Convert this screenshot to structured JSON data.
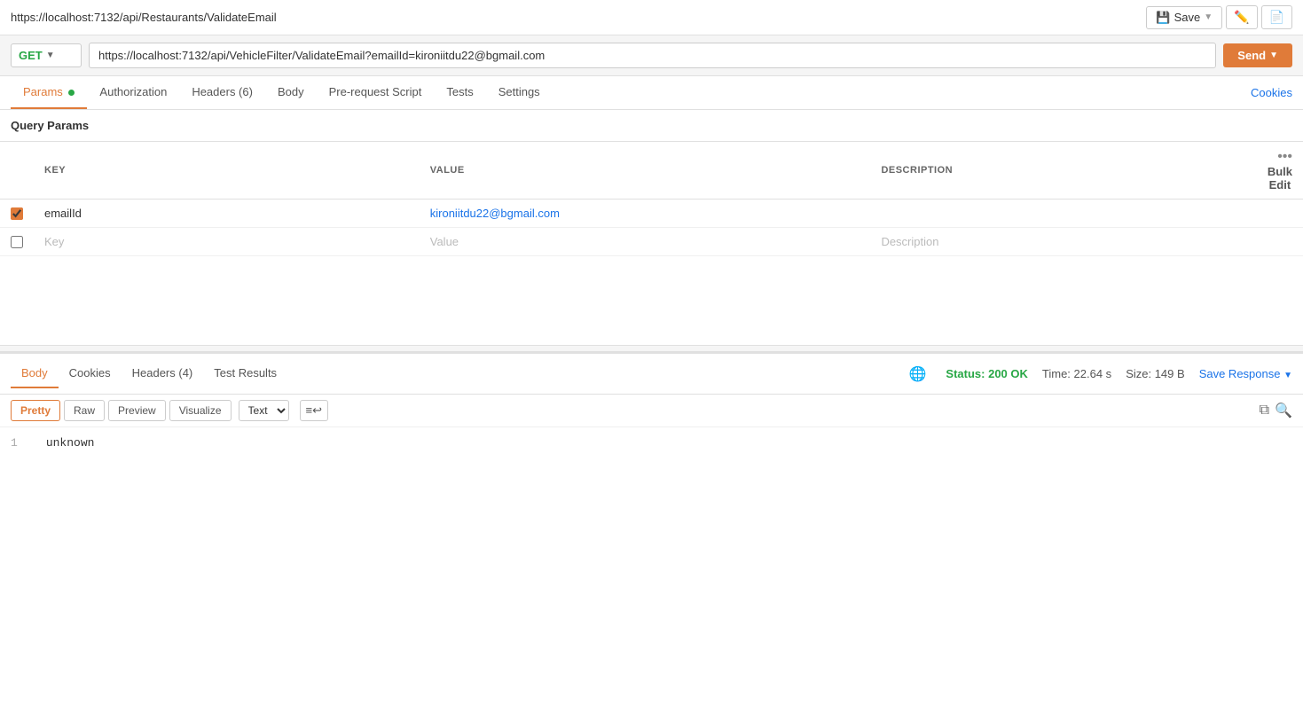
{
  "topbar": {
    "title": "https://localhost:7132/api/Restaurants/ValidateEmail",
    "save_label": "Save"
  },
  "urlbar": {
    "method": "GET",
    "url": "https://localhost:7132/api/VehicleFilter/ValidateEmail?emailId=kironiitdu22@bgmail.com",
    "send_label": "Send"
  },
  "request_tabs": [
    {
      "id": "params",
      "label": "Params",
      "active": true,
      "dot": true
    },
    {
      "id": "authorization",
      "label": "Authorization",
      "active": false,
      "dot": false
    },
    {
      "id": "headers",
      "label": "Headers (6)",
      "active": false,
      "dot": false
    },
    {
      "id": "body",
      "label": "Body",
      "active": false,
      "dot": false
    },
    {
      "id": "pre-request",
      "label": "Pre-request Script",
      "active": false,
      "dot": false
    },
    {
      "id": "tests",
      "label": "Tests",
      "active": false,
      "dot": false
    },
    {
      "id": "settings",
      "label": "Settings",
      "active": false,
      "dot": false
    }
  ],
  "cookies_link": "Cookies",
  "query_params": {
    "section_label": "Query Params",
    "columns": {
      "key": "KEY",
      "value": "VALUE",
      "description": "DESCRIPTION"
    },
    "bulk_edit_label": "Bulk Edit",
    "rows": [
      {
        "checked": true,
        "key": "emailId",
        "value": "kironiitdu22@bgmail.com",
        "description": ""
      }
    ],
    "empty_row": {
      "key_placeholder": "Key",
      "value_placeholder": "Value",
      "description_placeholder": "Description"
    }
  },
  "response": {
    "tabs": [
      {
        "id": "body",
        "label": "Body",
        "active": true
      },
      {
        "id": "cookies",
        "label": "Cookies",
        "active": false
      },
      {
        "id": "headers",
        "label": "Headers (4)",
        "active": false
      },
      {
        "id": "test-results",
        "label": "Test Results",
        "active": false
      }
    ],
    "status": "Status: 200 OK",
    "time": "Time: 22.64 s",
    "size": "Size: 149 B",
    "save_response_label": "Save Response",
    "format_tabs": [
      {
        "id": "pretty",
        "label": "Pretty",
        "active": true
      },
      {
        "id": "raw",
        "label": "Raw",
        "active": false
      },
      {
        "id": "preview",
        "label": "Preview",
        "active": false
      },
      {
        "id": "visualize",
        "label": "Visualize",
        "active": false
      }
    ],
    "text_format": "Text",
    "body_lines": [
      {
        "number": "1",
        "content": "unknown"
      }
    ]
  }
}
